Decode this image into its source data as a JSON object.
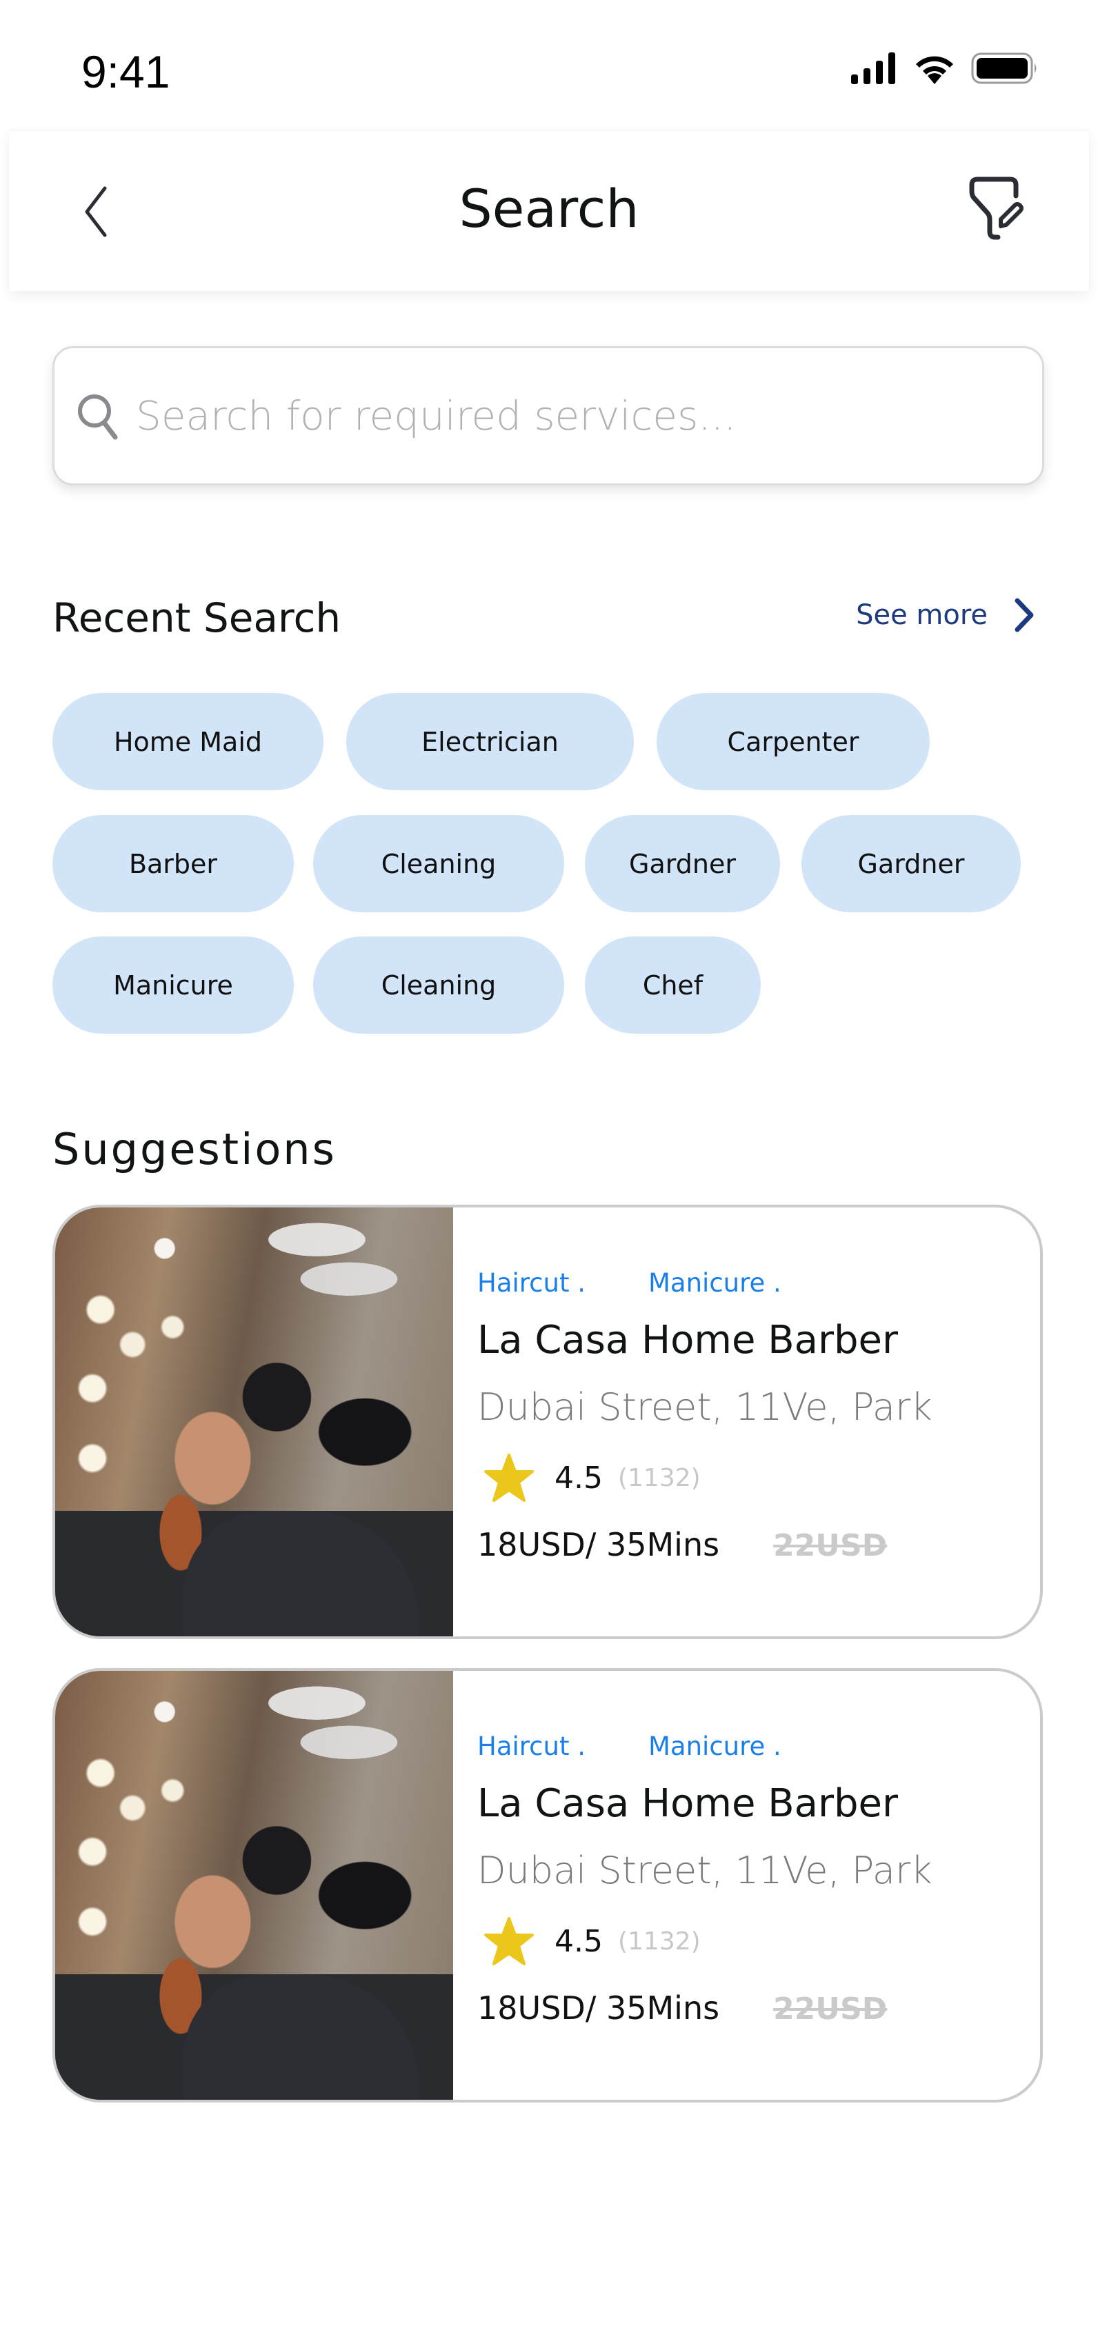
{
  "status_bar": {
    "time": "9:41",
    "icons": [
      "cellular-signal-icon",
      "wifi-icon",
      "battery-icon"
    ]
  },
  "header": {
    "title": "Search",
    "back_icon": "chevron-left-icon",
    "filter_icon": "filter-edit-icon"
  },
  "search": {
    "icon": "search-icon",
    "value": "",
    "placeholder": "Search for required services..."
  },
  "recent_search": {
    "title": "Recent Search",
    "see_more_label": "See more",
    "chips": [
      {
        "label": "Home Maid"
      },
      {
        "label": "Electrician"
      },
      {
        "label": "Carpenter"
      },
      {
        "label": "Barber"
      },
      {
        "label": "Cleaning"
      },
      {
        "label": "Gardner"
      },
      {
        "label": "Gardner"
      },
      {
        "label": "Manicure"
      },
      {
        "label": "Cleaning"
      },
      {
        "label": "Chef"
      }
    ]
  },
  "suggestions": {
    "title": "Suggestions",
    "cards": [
      {
        "image": "barber-photo",
        "tags": [
          "Haircut .",
          "Manicure ."
        ],
        "name": "La Casa Home Barber",
        "address": "Dubai Street, 11Ve, Park",
        "rating": "4.5",
        "review_count": "(1132)",
        "price": "18USD/ 35Mins",
        "old_price": "22USD"
      },
      {
        "image": "barber-photo",
        "tags": [
          "Haircut .",
          "Manicure ."
        ],
        "name": "La Casa Home Barber",
        "address": "Dubai Street, 11Ve, Park",
        "rating": "4.5",
        "review_count": "(1132)",
        "price": "18USD/ 35Mins",
        "old_price": "22USD"
      }
    ]
  },
  "colors": {
    "chip_bg": "#d2e4f8",
    "link": "#1e3a7e",
    "tag": "#1a7fe8",
    "star": "#ebc71c",
    "muted": "#7a7a7a",
    "strikethrough": "#cacaca"
  }
}
